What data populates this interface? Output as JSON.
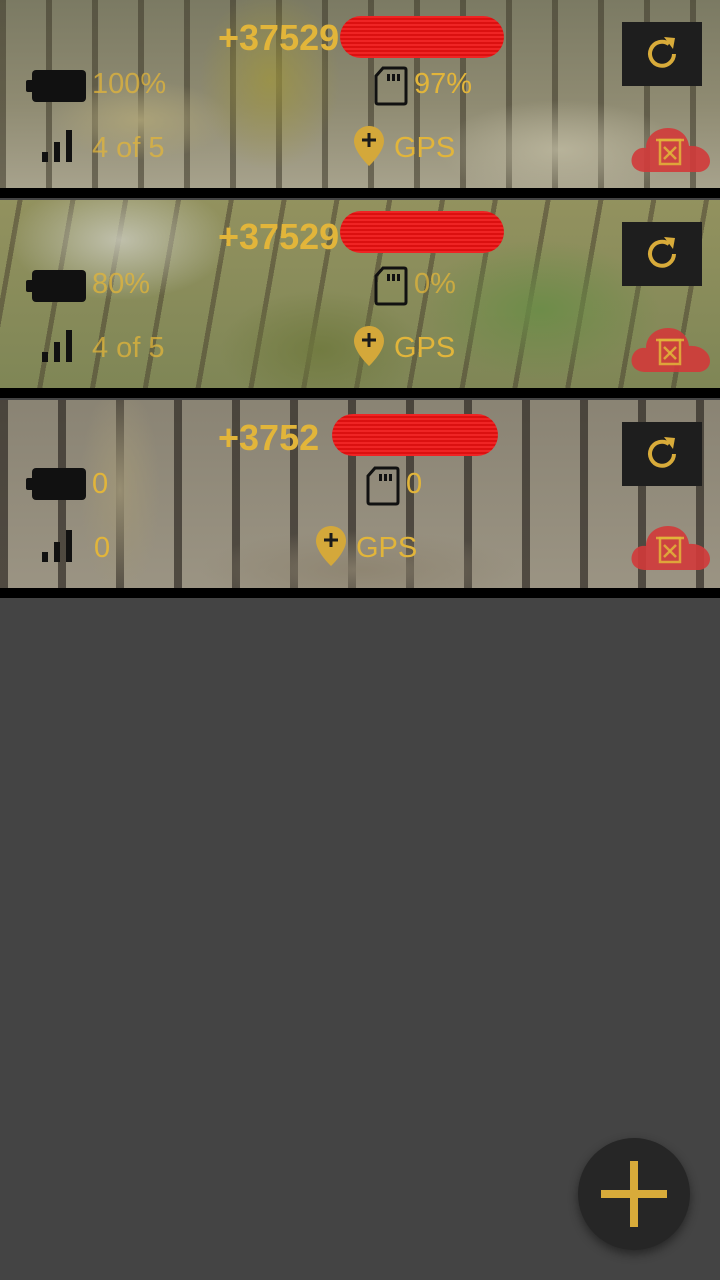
{
  "devices": [
    {
      "phone": "+37529",
      "battery": "100%",
      "storage": "97%",
      "signal": "4 of 5",
      "gps": "GPS"
    },
    {
      "phone": "+37529",
      "battery": "80%",
      "storage": "0%",
      "signal": "4 of 5",
      "gps": "GPS"
    },
    {
      "phone": "+3752",
      "battery": "0",
      "storage": "0",
      "signal": "0",
      "gps": "GPS"
    }
  ],
  "icons": {
    "battery": "battery-icon",
    "storage": "sd-card-icon",
    "signal": "signal-bars-icon",
    "gps": "map-pin-plus-icon",
    "refresh": "refresh-icon",
    "delete": "cloud-delete-icon",
    "add": "plus-icon"
  },
  "colors": {
    "accent": "#e2b53a",
    "background": "#444444",
    "button": "#1e1e1e",
    "delete": "#d23a3a",
    "redaction": "#ee1111"
  }
}
